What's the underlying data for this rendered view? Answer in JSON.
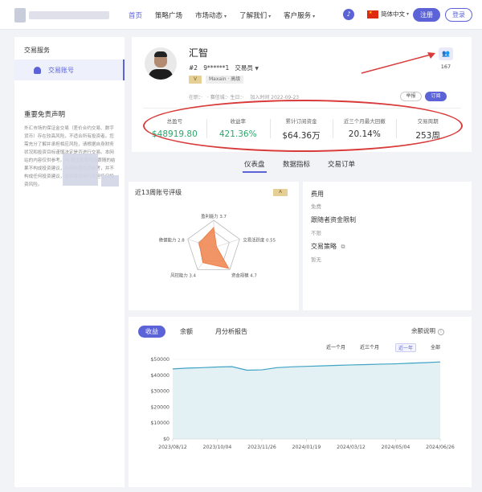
{
  "nav": {
    "items": [
      {
        "label": "首页",
        "active": true,
        "caret": false
      },
      {
        "label": "策略广场",
        "active": false,
        "caret": false
      },
      {
        "label": "市场动态",
        "active": false,
        "caret": true
      },
      {
        "label": "了解我们",
        "active": false,
        "caret": true
      },
      {
        "label": "客户服务",
        "active": false,
        "caret": true
      }
    ],
    "language": "简体中文",
    "register": "注册",
    "login": "登录",
    "accent": "#5b63d6"
  },
  "sidebar": {
    "section_title": "交易服务",
    "item_label": "交易账号",
    "disclaimer_title": "重要免责声明",
    "disclaimer_text": "外汇市场的保证金交易（差价合约交易、数字货币）存在较高风险，不适合所有投资者。您需充分了解并承担相应风险，请根据自身财务状况和投资目标谨慎决定是否进行交易。本网站的内容仅供参考。m 请注意本网站跟随的结果不构成投资建议，所有信息仅供参考，并不构成任何投资建议，投资者应自行承担任何投资风险。"
  },
  "profile": {
    "name": "汇智",
    "rank": "#2",
    "account": "9******1",
    "role": "交易员",
    "badge_v": "V",
    "broker": "Maxain · 高级",
    "info": "在职：·　·  赛信城：·  生日：·  　加入时间 2022-09-23",
    "follow_count": "167",
    "report": "举报",
    "subscribe": "订阅"
  },
  "stats": [
    {
      "label": "总盈亏",
      "value": "$48919.80",
      "color": "green"
    },
    {
      "label": "收益率",
      "value": "421.36%",
      "color": "green"
    },
    {
      "label": "累计订阅资金",
      "value": "$64.36万",
      "color": "default"
    },
    {
      "label": "近三个月最大回撤",
      "value": "20.14%",
      "color": "default"
    },
    {
      "label": "交易周期",
      "value": "253周",
      "color": "default"
    }
  ],
  "tabs": [
    "仪表盘",
    "数据指标",
    "交易订单"
  ],
  "evaluation": {
    "title": "近13周账号评级",
    "badge": "A",
    "axes": [
      {
        "label": "盈利能力",
        "value": 3.7
      },
      {
        "label": "交易活跃度",
        "value": 0.55
      },
      {
        "label": "资金规模",
        "value": 4.7
      },
      {
        "label": "风控能力",
        "value": 3.4
      },
      {
        "label": "稳健能力",
        "value": 2.8
      }
    ],
    "max": 5
  },
  "fees": {
    "fee_label": "费用",
    "fee_value": "免费",
    "limit_label": "跟随者资金限制",
    "limit_value": "不限",
    "strategy_label": "交易策略",
    "strategy_value": "暂无"
  },
  "chart_tabs": [
    "收益",
    "余额",
    "月分析报告"
  ],
  "balance_note": "余额说明",
  "ranges": [
    "近一个月",
    "近三个月",
    "近一年",
    "全部"
  ],
  "chart_data": {
    "type": "area",
    "x": [
      "2023/08/12",
      "2023/10/04",
      "2023/11/26",
      "2024/01/19",
      "2024/03/12",
      "2024/05/04",
      "2024/06/26"
    ],
    "ylim": [
      0,
      50000
    ],
    "yticks": [
      "$0",
      "$10000",
      "$20000",
      "$30000",
      "$40000",
      "$50000"
    ],
    "series": [
      {
        "values": [
          44000,
          44500,
          44800,
          45200,
          45400,
          43200,
          43400,
          44800,
          45300,
          45600,
          45900,
          46200,
          46500,
          46700,
          47000,
          47200,
          47600,
          47900,
          48400
        ]
      }
    ],
    "line_color": "#3fa3c4",
    "fill_color": "#e3f1f4"
  }
}
